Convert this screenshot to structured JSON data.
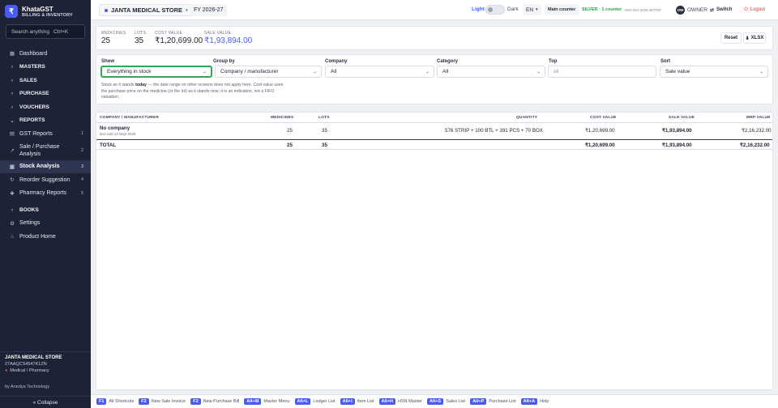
{
  "brand": {
    "title": "KhataGST",
    "subtitle": "BILLING & INVENTORY",
    "logo": "₹"
  },
  "search": {
    "placeholder": "Search anything",
    "shortcut": "Ctrl+K"
  },
  "nav": {
    "dashboard": "Dashboard",
    "masters": "MASTERS",
    "sales": "SALES",
    "purchase": "PURCHASE",
    "vouchers": "VOUCHERS",
    "reports": "REPORTS",
    "gst_reports": {
      "label": "GST Reports",
      "num": "1"
    },
    "sale_purchase": {
      "label": "Sale / Purchase Analysis",
      "num": "2"
    },
    "stock_analysis": {
      "label": "Stock Analysis",
      "num": "3"
    },
    "reorder": {
      "label": "Reorder Suggestion",
      "num": "4"
    },
    "pharmacy": {
      "label": "Pharmacy Reports",
      "num": "5"
    },
    "books": "BOOKS",
    "settings": "Settings",
    "product_home": "Product Home"
  },
  "store_footer": {
    "name": "JANTA MEDICAL STORE",
    "gstin": "27AAQCS4547K1ZN",
    "type": "Medical / Pharmacy",
    "by": "by Anedya Technology"
  },
  "collapse": "« Collapse",
  "topbar": {
    "store": "JANTA MEDICAL STORE",
    "fy": "FY 2026-27",
    "light": "Light",
    "dark": "Dark",
    "lang": "EN",
    "main_counter": "Main counter",
    "counter_plan": "SILVER · 1 counter",
    "counter_code": "ANO-SLV-2026-4E7F97",
    "avatar": "OW",
    "role": "OWNER",
    "switch": "Switch",
    "logout": "Logout"
  },
  "stats": {
    "medicines": {
      "label": "MEDICINES",
      "value": "25"
    },
    "lots": {
      "label": "LOTS",
      "value": "35"
    },
    "cost_value": {
      "label": "COST VALUE",
      "value": "₹1,20,699.00"
    },
    "sale_value": {
      "label": "SALE VALUE",
      "value": "₹1,93,894.00"
    },
    "reset": "Reset",
    "xlsx": "XLSX"
  },
  "filters": {
    "show": {
      "label": "Show",
      "value": "Everything in stock"
    },
    "group_by": {
      "label": "Group by",
      "value": "Company / manufacturer"
    },
    "company": {
      "label": "Company",
      "value": "All"
    },
    "category": {
      "label": "Category",
      "value": "All"
    },
    "top": {
      "label": "Top",
      "placeholder": "all"
    },
    "sort": {
      "label": "Sort",
      "value": "Sale value"
    }
  },
  "note": {
    "before": "Stock as it stands ",
    "bold": "today",
    "after": " — the date range on other screens does not apply here. Cost value uses the purchase price on the medicine (or the lot) as it stands now; it is an indication, not a FIFO valuation."
  },
  "table": {
    "headers": [
      "COMPANY / MANUFACTURER",
      "MEDICINES",
      "LOTS",
      "QUANTITY",
      "COST VALUE",
      "SALE VALUE",
      "MRP VALUE"
    ],
    "row": {
      "company": "No company",
      "sub": "last sold 13 Sept 2026",
      "medicines": "25",
      "lots": "35",
      "quantity": "576 STRIP + 100 BTL + 391 PCS + 70 BOX",
      "cost": "₹1,20,699.00",
      "sale": "₹1,93,894.00",
      "mrp": "₹2,16,232.00"
    },
    "total": {
      "label": "TOTAL",
      "medicines": "25",
      "lots": "35",
      "cost": "₹1,20,699.00",
      "sale": "₹1,93,894.00",
      "mrp": "₹2,16,232.00"
    }
  },
  "shortcuts": [
    {
      "key": "F1",
      "label": "All Shortcuts"
    },
    {
      "key": "F2",
      "label": "New Sale Invoice"
    },
    {
      "key": "F3",
      "label": "New Purchase Bill"
    },
    {
      "key": "Alt+M",
      "label": "Master Menu"
    },
    {
      "key": "Alt+L",
      "label": "Ledger List"
    },
    {
      "key": "Alt+I",
      "label": "Item List"
    },
    {
      "key": "Alt+H",
      "label": "HSN Master"
    },
    {
      "key": "Alt+S",
      "label": "Sales List"
    },
    {
      "key": "Alt+P",
      "label": "Purchase List"
    },
    {
      "key": "Alt+A",
      "label": "Help"
    }
  ],
  "colors": {
    "accent": "#4a5cf0",
    "sidebar": "#1d2236",
    "focus": "#2faa55",
    "plan": "#2f9a4d",
    "logout": "#d63a3a"
  }
}
